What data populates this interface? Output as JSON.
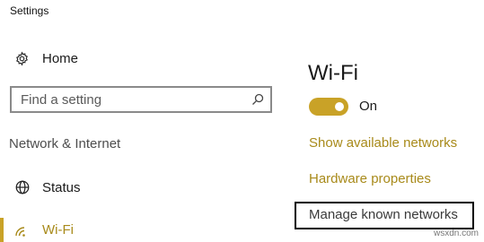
{
  "window": {
    "title": "Settings"
  },
  "sidebar": {
    "home_label": "Home",
    "search": {
      "placeholder": "Find a setting",
      "value": ""
    },
    "section_heading": "Network & Internet",
    "items": [
      {
        "label": "Status",
        "icon": "globe-icon"
      },
      {
        "label": "Wi-Fi",
        "icon": "wifi-icon",
        "selected": true
      }
    ]
  },
  "main": {
    "page_title": "Wi-Fi",
    "toggle": {
      "state_label": "On",
      "checked": true
    },
    "links": {
      "show_networks": "Show available networks",
      "hardware_properties": "Hardware properties",
      "manage_known_networks": "Manage known networks"
    }
  },
  "watermark": "wsxdn.com",
  "colors": {
    "accent": "#c9a227",
    "link": "#a88a1a",
    "text": "#1a1a1a",
    "section_heading": "#4d4d4d",
    "highlight_border": "#000000"
  }
}
